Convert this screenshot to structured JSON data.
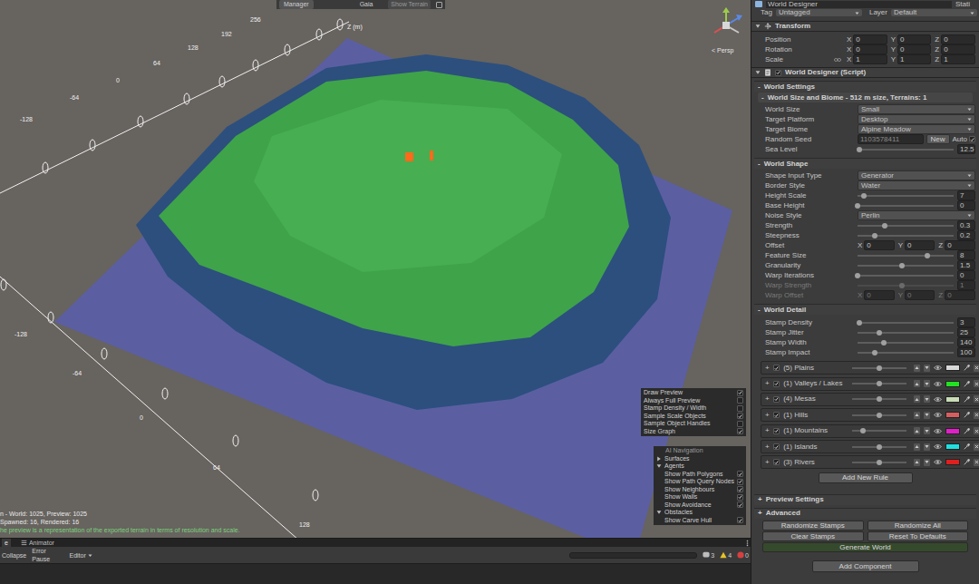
{
  "scene": {
    "toolbar": {
      "tabs": [
        {
          "label": "Manager",
          "selected": true
        },
        {
          "label": "Gaia",
          "selected": false
        }
      ],
      "button": "Show Terrain"
    },
    "axis_name": "Z (m)",
    "axis_top_ticks": [
      "256",
      "192",
      "128",
      "64",
      "0",
      "-64",
      "-128"
    ],
    "axis_left_ticks": [
      "-128",
      "-64",
      "0",
      "64",
      "128"
    ],
    "view_mode": "< Persp",
    "status_lines": [
      "n - World: 1025, Preview: 1025",
      "Spawned: 16, Rendered: 16"
    ],
    "info_line": "he preview is a representation of the exported terrain in terms of resolution and scale.",
    "preview_options": [
      {
        "label": "Draw Preview",
        "checked": true
      },
      {
        "label": "Always Full Preview",
        "checked": false
      },
      {
        "label": "Stamp Density / Width",
        "checked": false
      },
      {
        "label": "Sample Scale Objects",
        "checked": true
      },
      {
        "label": "Sample Object Handles",
        "checked": false
      },
      {
        "label": "Size Graph",
        "checked": true
      }
    ],
    "ai_navigation": {
      "title": "AI Navigation",
      "sections": [
        {
          "label": "Surfaces",
          "expanded": false,
          "items": []
        },
        {
          "label": "Agents",
          "expanded": true,
          "items": [
            {
              "label": "Show Path Polygons",
              "checked": true
            },
            {
              "label": "Show Path Query Nodes",
              "checked": true
            },
            {
              "label": "Show Neighbours",
              "checked": true
            },
            {
              "label": "Show Walls",
              "checked": true
            },
            {
              "label": "Show Avoidance",
              "checked": true
            }
          ]
        },
        {
          "label": "Obstacles",
          "expanded": true,
          "items": [
            {
              "label": "Show Carve Hull",
              "checked": true
            }
          ]
        }
      ]
    }
  },
  "console": {
    "tabs": [
      {
        "label": "e",
        "selected": true
      },
      {
        "label": "Animator",
        "selected": false
      }
    ],
    "toggles": [
      "Collapse",
      "Error Pause"
    ],
    "dropdown": "Editor",
    "counts": [
      {
        "kind": "info",
        "value": "3"
      },
      {
        "kind": "warning",
        "value": "4"
      },
      {
        "kind": "error",
        "value": "0"
      }
    ]
  },
  "inspector": {
    "object_name": "World Designer",
    "static_label": "Stati",
    "tag": {
      "label": "Tag",
      "value": "Untagged"
    },
    "layer": {
      "label": "Layer",
      "value": "Default"
    },
    "transform": {
      "title": "Transform",
      "rows": [
        {
          "label": "Position",
          "values": [
            {
              "axis": "X",
              "value": "0"
            },
            {
              "axis": "Y",
              "value": "0"
            },
            {
              "axis": "Z",
              "value": "0"
            }
          ]
        },
        {
          "label": "Rotation",
          "values": [
            {
              "axis": "X",
              "value": "0"
            },
            {
              "axis": "Y",
              "value": "0"
            },
            {
              "axis": "Z",
              "value": "0"
            }
          ]
        },
        {
          "label": "Scale",
          "values": [
            {
              "axis": "X",
              "value": "1"
            },
            {
              "axis": "Y",
              "value": "1"
            },
            {
              "axis": "Z",
              "value": "1"
            }
          ]
        }
      ]
    },
    "component": {
      "title": "World Designer (Script)",
      "enabled": true
    },
    "world_settings": {
      "expander": "-",
      "title": "World Settings",
      "sub_expander": "-",
      "subtitle": "World Size and Biome - 512 m size, Terrains: 1",
      "fields": [
        {
          "kind": "dropdown",
          "label": "World Size",
          "value": "Small",
          "disabled": false
        },
        {
          "kind": "dropdown",
          "label": "Target Platform",
          "value": "Desktop",
          "disabled": false
        },
        {
          "kind": "dropdown",
          "label": "Target Biome",
          "value": "Alpine Meadow",
          "disabled": false
        },
        {
          "kind": "seed",
          "label": "Random Seed",
          "value": "1103578411",
          "button": "New",
          "toggle": "Auto",
          "toggle_checked": true,
          "disabled": false
        },
        {
          "kind": "slider",
          "label": "Sea Level",
          "value": "12.5",
          "level": 0.02,
          "disabled": false
        }
      ]
    },
    "world_shape": {
      "expander": "-",
      "title": "World Shape",
      "fields": [
        {
          "kind": "dropdown",
          "label": "Shape Input Type",
          "value": "Generator",
          "disabled": false
        },
        {
          "kind": "dropdown",
          "label": "Border Style",
          "value": "Water",
          "disabled": false
        },
        {
          "kind": "slider",
          "label": "Height Scale",
          "value": "7",
          "level": 0.07,
          "disabled": false
        },
        {
          "kind": "slider",
          "label": "Base Height",
          "value": "0",
          "level": 0,
          "disabled": false
        },
        {
          "kind": "dropdown",
          "label": "Noise Style",
          "value": "Perlin",
          "disabled": false
        },
        {
          "kind": "slider",
          "label": "Strength",
          "value": "0.3",
          "level": 0.28,
          "disabled": false
        },
        {
          "kind": "slider",
          "label": "Steepness",
          "value": "0.2",
          "level": 0.18,
          "disabled": false
        },
        {
          "kind": "vector",
          "label": "Offset",
          "values": [
            {
              "axis": "X",
              "value": "0"
            },
            {
              "axis": "Y",
              "value": "0"
            },
            {
              "axis": "Z",
              "value": "0"
            }
          ],
          "disabled": false
        },
        {
          "kind": "slider",
          "label": "Feature Size",
          "value": "8",
          "level": 0.73,
          "disabled": false
        },
        {
          "kind": "slider",
          "label": "Granularity",
          "value": "1.5",
          "level": 0.46,
          "disabled": false
        },
        {
          "kind": "slider",
          "label": "Warp Iterations",
          "value": "0",
          "level": 0,
          "disabled": false
        },
        {
          "kind": "slider",
          "label": "Warp Strength",
          "value": "1",
          "level": 0.46,
          "disabled": true
        },
        {
          "kind": "vector",
          "label": "Warp Offset",
          "values": [
            {
              "axis": "X",
              "value": "0"
            },
            {
              "axis": "Y",
              "value": "0"
            },
            {
              "axis": "Z",
              "value": "0"
            }
          ],
          "disabled": true
        }
      ]
    },
    "world_detail": {
      "expander": "-",
      "title": "World Detail",
      "fields": [
        {
          "kind": "slider",
          "label": "Stamp Density",
          "value": "3",
          "level": 0.02,
          "disabled": false
        },
        {
          "kind": "slider",
          "label": "Stamp Jitter",
          "value": "25",
          "level": 0.23,
          "disabled": false
        },
        {
          "kind": "slider",
          "label": "Stamp Width",
          "value": "140",
          "level": 0.27,
          "disabled": false
        },
        {
          "kind": "slider",
          "label": "Stamp Impact",
          "value": "100",
          "level": 0.18,
          "disabled": false
        }
      ],
      "rules": [
        {
          "expander": "+",
          "label": "(5) Plains",
          "enabled": true,
          "level": 0.5,
          "color": "#d9d9d9"
        },
        {
          "expander": "+",
          "label": "(1) Valleys / Lakes",
          "enabled": true,
          "level": 0.5,
          "color": "#22e022"
        },
        {
          "expander": "+",
          "label": "(4) Mesas",
          "enabled": true,
          "level": 0.5,
          "color": "#c9dcb6"
        },
        {
          "expander": "+",
          "label": "(1) Hills",
          "enabled": true,
          "level": 0.5,
          "color": "#d55f5f"
        },
        {
          "expander": "+",
          "label": "(1) Mountains",
          "enabled": true,
          "level": 0.2,
          "color": "#e01fc8"
        },
        {
          "expander": "+",
          "label": "(1) Islands",
          "enabled": true,
          "level": 0.5,
          "color": "#1fe0e0"
        },
        {
          "expander": "+",
          "label": "(3) Rivers",
          "enabled": true,
          "level": 0.5,
          "color": "#e01f1f"
        }
      ],
      "add_rule": "Add New Rule"
    },
    "collapsed_sections": [
      {
        "expander": "+",
        "title": "Preview Settings"
      },
      {
        "expander": "+",
        "title": "Advanced"
      }
    ],
    "button_rows": [
      [
        "Randomize Stamps",
        "Randomize All"
      ],
      [
        "Clear Stamps",
        "Reset To Defaults"
      ]
    ],
    "generate": "Generate World",
    "add_component": "Add Component"
  }
}
